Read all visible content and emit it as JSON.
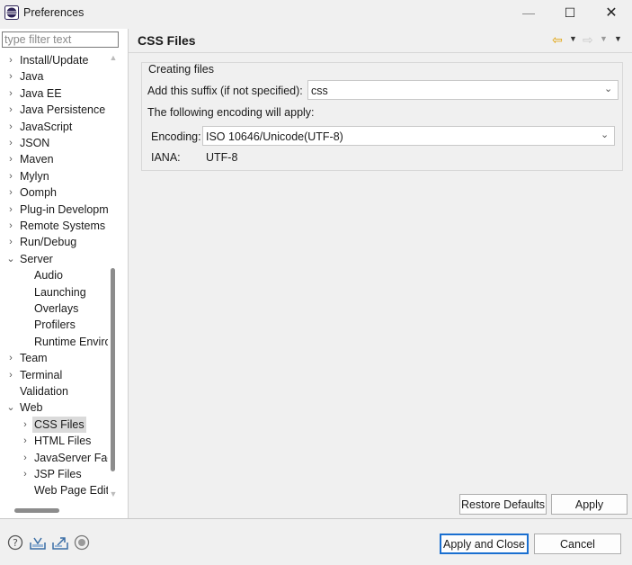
{
  "window": {
    "title": "Preferences",
    "minimize": "—",
    "maximize": "☐",
    "close": "✕"
  },
  "filter": {
    "placeholder": "type filter text",
    "value": ""
  },
  "tree": [
    {
      "label": "Install/Update",
      "level": 0,
      "expander": "›"
    },
    {
      "label": "Java",
      "level": 0,
      "expander": "›"
    },
    {
      "label": "Java EE",
      "level": 0,
      "expander": "›"
    },
    {
      "label": "Java Persistence",
      "level": 0,
      "expander": "›"
    },
    {
      "label": "JavaScript",
      "level": 0,
      "expander": "›"
    },
    {
      "label": "JSON",
      "level": 0,
      "expander": "›"
    },
    {
      "label": "Maven",
      "level": 0,
      "expander": "›"
    },
    {
      "label": "Mylyn",
      "level": 0,
      "expander": "›"
    },
    {
      "label": "Oomph",
      "level": 0,
      "expander": "›"
    },
    {
      "label": "Plug-in Development",
      "level": 0,
      "expander": "›"
    },
    {
      "label": "Remote Systems",
      "level": 0,
      "expander": "›"
    },
    {
      "label": "Run/Debug",
      "level": 0,
      "expander": "›"
    },
    {
      "label": "Server",
      "level": 0,
      "expander": "⌄"
    },
    {
      "label": "Audio",
      "level": 1,
      "expander": ""
    },
    {
      "label": "Launching",
      "level": 1,
      "expander": ""
    },
    {
      "label": "Overlays",
      "level": 1,
      "expander": ""
    },
    {
      "label": "Profilers",
      "level": 1,
      "expander": ""
    },
    {
      "label": "Runtime Environments",
      "level": 1,
      "expander": ""
    },
    {
      "label": "Team",
      "level": 0,
      "expander": "›"
    },
    {
      "label": "Terminal",
      "level": 0,
      "expander": "›"
    },
    {
      "label": "Validation",
      "level": 0,
      "expander": ""
    },
    {
      "label": "Web",
      "level": 0,
      "expander": "⌄"
    },
    {
      "label": "CSS Files",
      "level": 1,
      "expander": "›",
      "selected": true
    },
    {
      "label": "HTML Files",
      "level": 1,
      "expander": "›"
    },
    {
      "label": "JavaServer Faces",
      "level": 1,
      "expander": "›"
    },
    {
      "label": "JSP Files",
      "level": 1,
      "expander": "›"
    },
    {
      "label": "Web Page Editor",
      "level": 1,
      "expander": ""
    }
  ],
  "page": {
    "title": "CSS Files",
    "group_title": "Creating files",
    "suffix_label": "Add this suffix (if not specified):",
    "suffix_value": "css",
    "encoding_info": "The following encoding will apply:",
    "encoding_label": "Encoding:",
    "encoding_value": "ISO 10646/Unicode(UTF-8)",
    "iana_label": "IANA:",
    "iana_value": "UTF-8"
  },
  "buttons": {
    "restore_defaults": "Restore Defaults",
    "apply": "Apply",
    "apply_and_close": "Apply and Close",
    "cancel": "Cancel"
  },
  "colors": {
    "accent_border": "#1a6fd0",
    "nav_back_arrow": "#e0a000",
    "selection_bg": "#dadada"
  }
}
